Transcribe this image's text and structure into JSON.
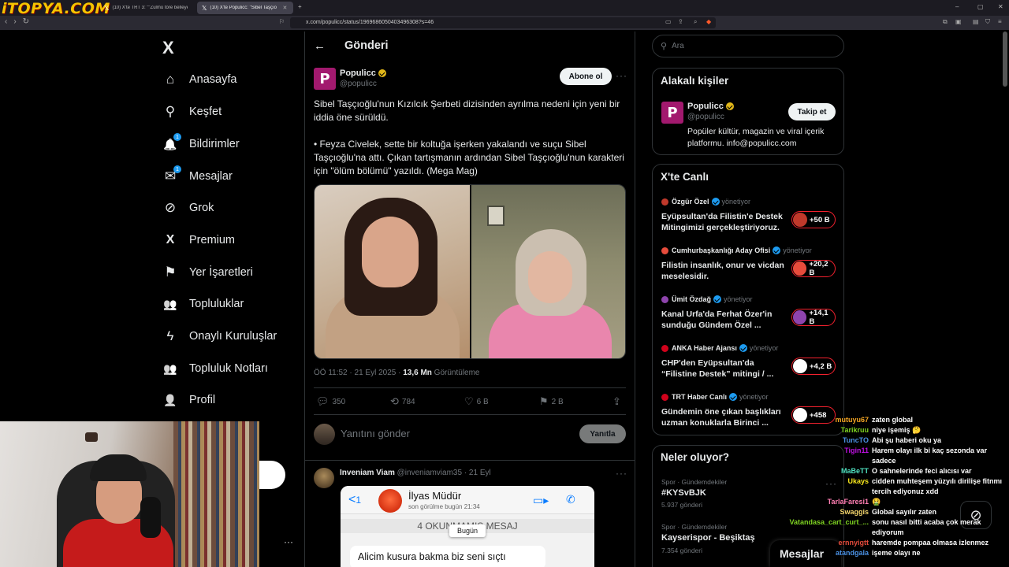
{
  "browser": {
    "site_logo": "iTOPYA.COM",
    "tabs": [
      {
        "label": "(10) X'te TRT 3: \"\"Zulmü töre belleyen"
      },
      {
        "label": "(10) X'te Populicc: \"Sibel Taşçıo"
      }
    ],
    "url": "x.com/populicc/status/1969686050403496308?s=46"
  },
  "nav": {
    "logo": "X",
    "items": [
      {
        "label": "Anasayfa",
        "icon": "home-icon",
        "glyph": "⌂"
      },
      {
        "label": "Keşfet",
        "icon": "search-icon",
        "glyph": "⚲"
      },
      {
        "label": "Bildirimler",
        "icon": "bell-icon",
        "glyph": "🔔",
        "badge": "1"
      },
      {
        "label": "Mesajlar",
        "icon": "mail-icon",
        "glyph": "✉",
        "badge": "1"
      },
      {
        "label": "Grok",
        "icon": "grok-icon",
        "glyph": "⊘"
      },
      {
        "label": "Premium",
        "icon": "x-premium-icon",
        "glyph": "X"
      },
      {
        "label": "Yer İşaretleri",
        "icon": "bookmark-icon",
        "glyph": "⚑"
      },
      {
        "label": "Topluluklar",
        "icon": "communities-icon",
        "glyph": "👥"
      },
      {
        "label": "Onaylı Kuruluşlar",
        "icon": "lightning-icon",
        "glyph": "ϟ"
      },
      {
        "label": "Topluluk Notları",
        "icon": "notes-icon",
        "glyph": "👥"
      },
      {
        "label": "Profil",
        "icon": "person-icon",
        "glyph": "👤"
      }
    ]
  },
  "header": {
    "title": "Gönderi"
  },
  "post": {
    "author_name": "Populicc",
    "author_handle": "@populicc",
    "follow_label": "Abone ol",
    "text_1": "Sibel Taşçıoğlu'nun Kızılcık Şerbeti dizisinden ayrılma nedeni için yeni bir iddia öne sürüldü.",
    "text_2": "• Feyza Civelek, sette bir koltuğa işerken yakalandı ve suçu Sibel Taşçıoğlu'na attı. Çıkan tartışmanın ardından Sibel Taşçıoğlu'nun karakteri için \"ölüm bölümü\" yazıldı. (Mega Mag)",
    "timestamp": "ÖÖ 11:52 · 21 Eyl 2025 · ",
    "views_count": "13,6 Mn",
    "views_label": " Görüntüleme",
    "replies": "350",
    "reposts": "784",
    "likes": "6 B",
    "bookmarks": "2 B"
  },
  "reply_box": {
    "placeholder": "Yanıtını gönder",
    "button": "Yanıtla"
  },
  "reply": {
    "name": "Inveniam Viam",
    "meta": "@inveniamviam35 · 21 Eyl",
    "wa": {
      "back": "<",
      "back_count": "1",
      "contact": "İlyas Müdür",
      "last_seen": "son görülme bugün 21:34",
      "unread": "4 OKUNMAMIŞ MESAJ",
      "bubble": "Alicim kusura bakma biz seni sıçtı",
      "tooltip": "Bugün"
    }
  },
  "search": {
    "placeholder": "Ara"
  },
  "related": {
    "title": "Alakalı kişiler",
    "name": "Populicc",
    "handle": "@populicc",
    "button": "Takip et",
    "bio": "Popüler kültür, magazin ve viral içerik platformu. info@populicc.com"
  },
  "live": {
    "title": "X'te Canlı",
    "items": [
      {
        "user": "Özgür Özel",
        "role": "yönetiyor",
        "title": "Eyüpsultan'da Filistin'e Destek Mitingimizi gerçekleştiriyoruz.",
        "count": "+50 B",
        "color": "#c0392b"
      },
      {
        "user": "Cumhurbaşkanlığı Aday Ofisi",
        "role": "yönetiyor",
        "title": "Filistin insanlık, onur ve vicdan meselesidir.",
        "count": "+20,2 B",
        "color": "#e74c3c"
      },
      {
        "user": "Ümit Özdağ",
        "role": "yönetiyor",
        "title": "Kanal Urfa'da Ferhat Özer'in sunduğu Gündem Özel ...",
        "count": "+14,1 B",
        "color": "#8e44ad"
      },
      {
        "user": "ANKA Haber Ajansı",
        "role": "yönetiyor",
        "title": "CHP'den Eyüpsultan'da “Filistine Destek” mitingi / ...",
        "count": "+4,2 B",
        "color": "#d0021b"
      },
      {
        "user": "TRT Haber Canlı",
        "role": "yönetiyor",
        "title": "Gündemin öne çıkan başlıkları uzman konuklarla Birinci ...",
        "count": "+458",
        "color": "#d0021b"
      }
    ]
  },
  "trends": {
    "title": "Neler oluyor?",
    "items": [
      {
        "category": "Spor · Gündemdekiler",
        "name": "#KYSvBJK",
        "count": "5.937 gönderi"
      },
      {
        "category": "Spor · Gündemdekiler",
        "name": "Kayserispor - Beşiktaş",
        "count": "7.354 gönderi"
      }
    ]
  },
  "messages_bar": {
    "label": "Mesajlar"
  },
  "chat": [
    {
      "user": "mutuyu67",
      "msg": "zaten global",
      "color": "#f5a623"
    },
    {
      "user": "Tarikruu",
      "msg": "niye işemiş 🤔",
      "color": "#7ed321"
    },
    {
      "user": "TuncTO",
      "msg": "Abi şu haberi oku ya",
      "color": "#4a90e2"
    },
    {
      "user": "Tigin11",
      "msg": "Harem olayı ilk bi kaç sezonda var sadece",
      "color": "#bd10e0"
    },
    {
      "user": "MaBeTT",
      "msg": "O sahnelerinde feci alıcısı var",
      "color": "#50e3c2"
    },
    {
      "user": "Ukays",
      "msg": "cidden muhteşem yüzyılı dirilişe fitnmı tercih ediyonuz xdd",
      "color": "#f8e71c"
    },
    {
      "user": "TarlaFaresi1",
      "msg": "🤮",
      "color": "#ff7eb3"
    },
    {
      "user": "Swaggis",
      "msg": "Global sayılır zaten",
      "color": "#f5d76e"
    },
    {
      "user": "Vatandasa_cart_curt_...",
      "msg": "sonu nasıl bitti acaba çok merak ediyorum",
      "color": "#7ed321"
    },
    {
      "user": "ernnyigtt",
      "msg": "haremde pompaa olmasa izlenmez",
      "color": "#e74c3c"
    },
    {
      "user": "atandgala",
      "msg": "işeme olayı ne",
      "color": "#4a90e2"
    }
  ]
}
